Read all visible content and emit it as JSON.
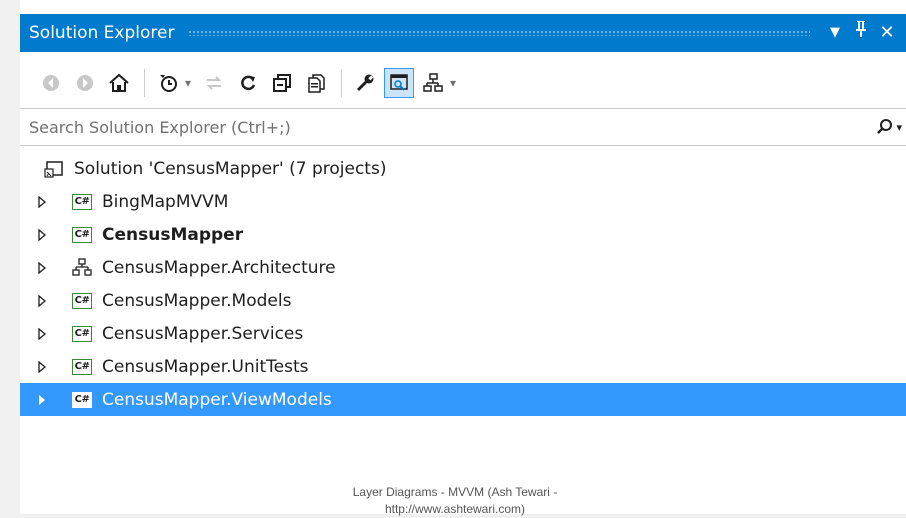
{
  "titlebar": {
    "title": "Solution Explorer",
    "dropdown_glyph": "▼",
    "pin_glyph": "ᚎ",
    "close_glyph": "✕"
  },
  "toolbar": {
    "buttons": [
      {
        "name": "back-icon"
      },
      {
        "name": "forward-icon"
      },
      {
        "name": "home-icon"
      },
      {
        "name": "pending-changes-icon",
        "has_dropdown": true
      },
      {
        "name": "sync-icon"
      },
      {
        "name": "refresh-icon"
      },
      {
        "name": "collapse-all-icon"
      },
      {
        "name": "show-all-files-icon"
      },
      {
        "name": "properties-icon"
      },
      {
        "name": "preview-selected-items-icon",
        "active": true
      },
      {
        "name": "class-view-icon",
        "has_dropdown": true
      }
    ],
    "dropdown_glyph": "▾"
  },
  "search": {
    "placeholder": "Search Solution Explorer (Ctrl+;)",
    "value": "",
    "dropdown_glyph": "▾"
  },
  "tree": {
    "solution_label": "Solution 'CensusMapper' (7 projects)",
    "projects": [
      {
        "label": "BingMapMVVM",
        "icon": "csharp-project-icon",
        "bold": false,
        "selected": false
      },
      {
        "label": "CensusMapper",
        "icon": "csharp-project-icon",
        "bold": true,
        "selected": false
      },
      {
        "label": "CensusMapper.Architecture",
        "icon": "modeling-project-icon",
        "bold": false,
        "selected": false
      },
      {
        "label": "CensusMapper.Models",
        "icon": "csharp-project-icon",
        "bold": false,
        "selected": false
      },
      {
        "label": "CensusMapper.Services",
        "icon": "csharp-project-icon",
        "bold": false,
        "selected": false
      },
      {
        "label": "CensusMapper.UnitTests",
        "icon": "csharp-project-icon",
        "bold": false,
        "selected": false
      },
      {
        "label": "CensusMapper.ViewModels",
        "icon": "csharp-project-icon",
        "bold": false,
        "selected": true
      }
    ],
    "cs_badge_text": "C#"
  },
  "footer": {
    "line1": "Layer Diagrams - MVVM (Ash Tewari -",
    "line2": "http://www.ashtewari.com)"
  },
  "colors": {
    "accent": "#007acc",
    "selection": "#3399ff",
    "icon_gray": "#717171"
  }
}
